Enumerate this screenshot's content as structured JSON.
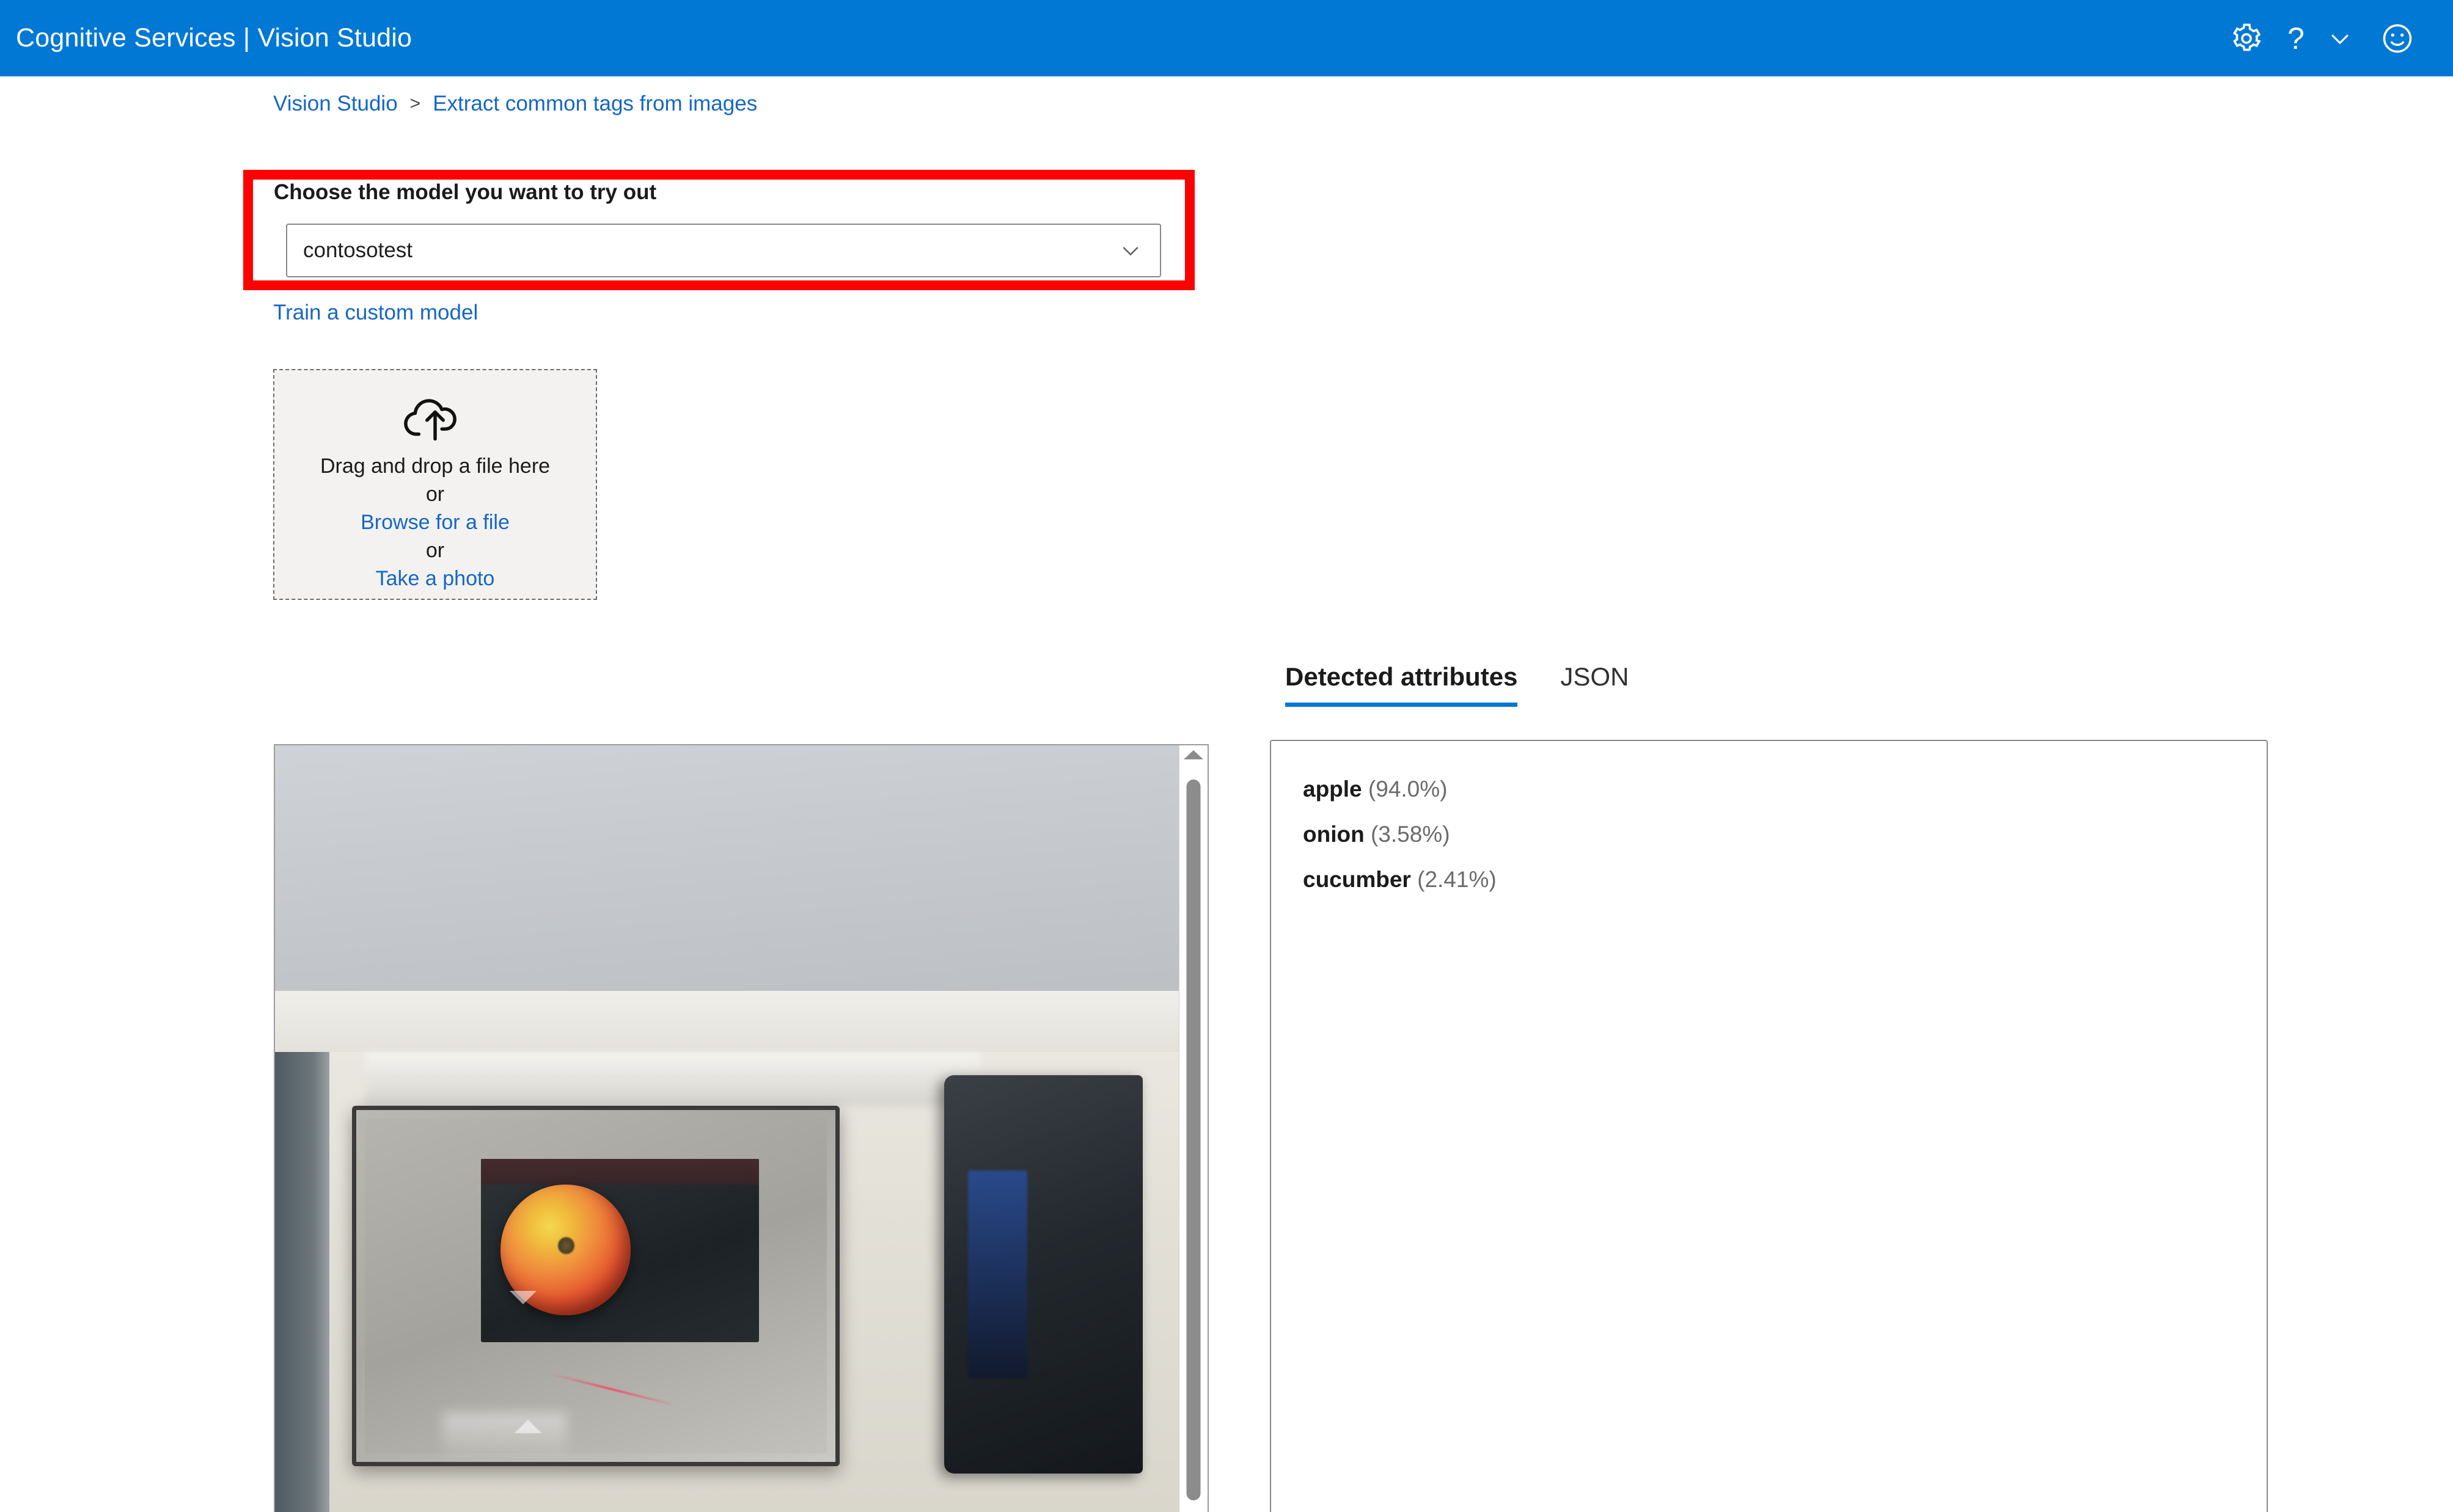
{
  "header": {
    "title": "Cognitive Services  |  Vision Studio",
    "brand_color": "#0078d4",
    "actions": [
      {
        "name": "settings",
        "icon": "gear-icon"
      },
      {
        "name": "help",
        "icon": "question-mark-icon",
        "label": "?"
      },
      {
        "name": "help-menu",
        "icon": "chevron-down-icon"
      },
      {
        "name": "feedback",
        "icon": "smiley-face-icon"
      }
    ]
  },
  "breadcrumb": {
    "root": "Vision Studio",
    "separator": ">",
    "current": "Extract common tags from images",
    "link_color": "#1567c4"
  },
  "model_picker": {
    "label": "Choose the model you want to try out",
    "selected_value": "contosotest",
    "chevron": "chevron-down-icon",
    "highlight_color": "#ff0000"
  },
  "train_link": {
    "label": "Train a custom model"
  },
  "dropzone": {
    "icon": "cloud-upload-icon",
    "primary_text": "Drag and drop a file here",
    "or_1": "or",
    "browse_link": "Browse for a file",
    "or_2": "or",
    "photo_link": "Take a photo"
  },
  "tabs": [
    {
      "label": "Detected attributes",
      "active": true
    },
    {
      "label": "JSON",
      "active": false
    }
  ],
  "results": [
    {
      "tag": "apple",
      "confidence": "(94.0%)"
    },
    {
      "tag": "onion",
      "confidence": "(3.58%)"
    },
    {
      "tag": "cucumber",
      "confidence": "(2.41%)"
    }
  ],
  "image_preview": {
    "alt": "Photograph of an apple resting on a supermarket self-checkout scanner scale",
    "scrollbar": {
      "name": "vertical-scrollbar",
      "up_arrow": "triangle-up-icon"
    }
  }
}
